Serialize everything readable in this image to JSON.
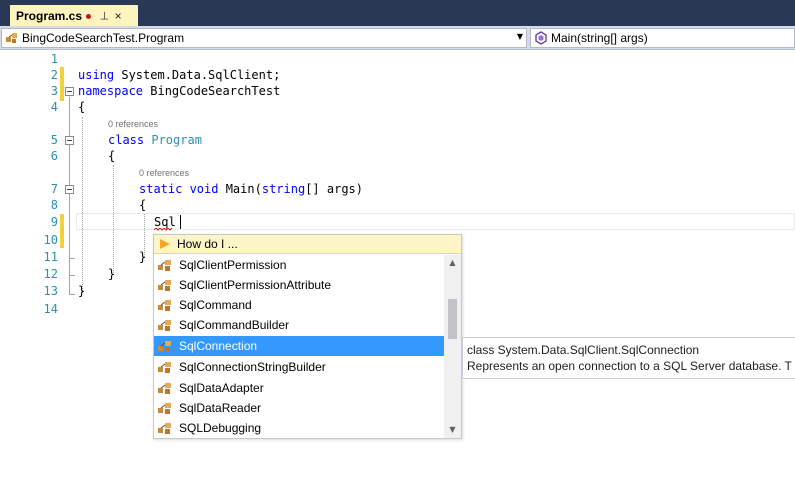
{
  "tab": {
    "filename": "Program.cs",
    "pin_glyph": "⊣",
    "close_glyph": "×"
  },
  "nav": {
    "class_path": "BingCodeSearchTest.Program",
    "member": "Main(string[] args)"
  },
  "editor": {
    "line_numbers": [
      "1",
      "2",
      "3",
      "4",
      "5",
      "6",
      "7",
      "8",
      "9",
      "10",
      "11",
      "12",
      "13",
      "14"
    ],
    "code": {
      "l2_kw": "using",
      "l2_rest": " System.Data.SqlClient;",
      "l3_kw": "namespace",
      "l3_rest": " BingCodeSearchTest",
      "l4": "{",
      "refs_class": "0 references",
      "l5_kw": "class",
      "l5_type": " Program",
      "l6": "{",
      "refs_main": "0 references",
      "l7_kw1": "static",
      "l7_kw2": " void",
      "l7_name": " Main(",
      "l7_kw3": "string",
      "l7_rest": "[] args)",
      "l8": "{",
      "l9": "Sql",
      "l11": "}",
      "l12": "}",
      "l13": "}"
    }
  },
  "completion": {
    "how_do_i": "How do I ...",
    "items": [
      "SqlClientPermission",
      "SqlClientPermissionAttribute",
      "SqlCommand",
      "SqlCommandBuilder",
      "SqlConnection",
      "SqlConnectionStringBuilder",
      "SqlDataAdapter",
      "SqlDataReader",
      "SQLDebugging"
    ],
    "selected": "SqlConnection"
  },
  "tooltip": {
    "signature": "class System.Data.SqlClient.SqlConnection",
    "description": "Represents an open connection to a SQL Server database. T"
  },
  "colors": {
    "keyword": "#0000ff",
    "type": "#2b91af",
    "selection": "#3399ff",
    "tab_active": "#fdf4bf",
    "change_marker": "#f2d13c"
  }
}
